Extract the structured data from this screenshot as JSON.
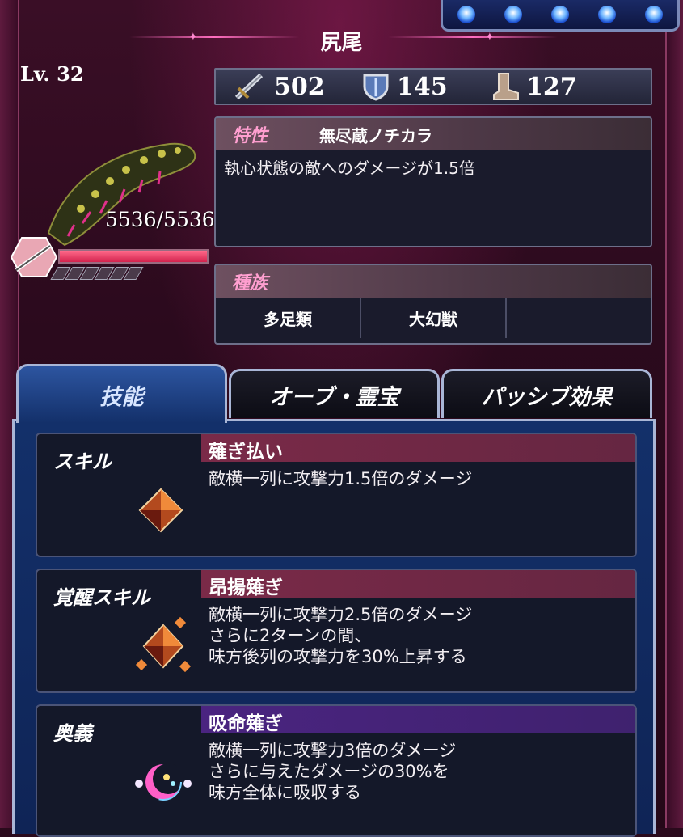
{
  "unit": {
    "name": "尻尾",
    "level": "Lv. 32",
    "hp": "5536/5536",
    "hp_fraction": 1.0
  },
  "stats": [
    {
      "icon": "sword-icon",
      "value": "502"
    },
    {
      "icon": "shield-icon",
      "value": "145"
    },
    {
      "icon": "boot-icon",
      "value": "127"
    }
  ],
  "trait": {
    "label": "特性",
    "name": "無尽蔵ノチカラ",
    "description": "執心状態の敵へのダメージが1.5倍"
  },
  "race": {
    "label": "種族",
    "values": [
      "多足類",
      "大幻獣",
      ""
    ]
  },
  "tabs": [
    {
      "label": "技能",
      "active": true
    },
    {
      "label": "オーブ・霊宝",
      "active": false
    },
    {
      "label": "パッシブ効果",
      "active": false
    }
  ],
  "skills": [
    {
      "type": "スキル",
      "name": "薙ぎ払い",
      "lines": [
        "敵横一列に攻撃力1.5倍のダメージ"
      ],
      "icon": "crystal-icon",
      "bar_color": "#7a2a48"
    },
    {
      "type": "覚醒スキル",
      "name": "昂揚薙ぎ",
      "lines": [
        "敵横一列に攻撃力2.5倍のダメージ",
        "さらに2ターンの間、",
        "味方後列の攻撃力を30%上昇する"
      ],
      "icon": "awakened-crystal-icon",
      "bar_color": "#7a2a48"
    },
    {
      "type": "奥義",
      "name": "吸命薙ぎ",
      "lines": [
        "敵横一列に攻撃力3倍のダメージ",
        "さらに与えたダメージの30%を",
        "味方全体に吸収する"
      ],
      "icon": "crescent-orb-icon",
      "bar_color": "#4a2480"
    }
  ],
  "colors": {
    "accent_pink": "#ff9fd0",
    "tab_blue": "#2d55a0",
    "hp_red": "#d3234e"
  }
}
